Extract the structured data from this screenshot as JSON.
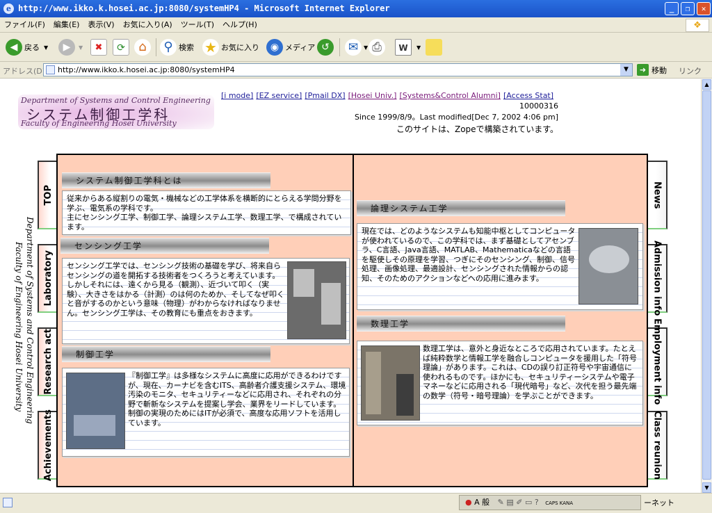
{
  "window": {
    "title": "http://www.ikko.k.hosei.ac.jp:8080/systemHP4 - Microsoft Internet Explorer"
  },
  "menu": [
    "ファイル(F)",
    "編集(E)",
    "表示(V)",
    "お気に入り(A)",
    "ツール(T)",
    "ヘルプ(H)"
  ],
  "toolbar": {
    "back": "戻る",
    "search": "検索",
    "favorites": "お気に入り",
    "media": "メディア"
  },
  "address": {
    "label": "アドレス(D)",
    "url": "http://www.ikko.k.hosei.ac.jp:8080/systemHP4",
    "go": "移動",
    "links": "リンク"
  },
  "header": {
    "logo_en_top": "Department of Systems and Control Engineering",
    "logo_jp": "システム制御工学科",
    "logo_en_bottom": "Faculty of Engineering Hosei University",
    "links": [
      "[i mode]",
      "[EZ service]",
      "[Pmail DX]",
      "[Hosei Univ.]",
      "[Systems&Control Alumni]",
      "[Access Stat]"
    ],
    "counter": "10000316",
    "since": "Since 1999/8/9。Last modified[Dec 7, 2002 4:06 pm]",
    "zope": "このサイトは、Zopeで構築されています。"
  },
  "sidebar_text": [
    "Department of Systems and Control Engineering",
    "Faculty of Engineering Hosei University"
  ],
  "tabs_left": [
    "TOP",
    "Laboratory",
    "Research act",
    "Achievements"
  ],
  "tabs_right": [
    "News",
    "Admission info",
    "Employment info",
    "Class reunion"
  ],
  "sections": {
    "about": {
      "title": "システム制御工学科とは",
      "text": "従来からある縦割りの電気・機械などの工学体系を横断的にとらえる学問分野を学ぶ、電気系の学科です。\n主にセンシング工学、制御工学、論理システム工学、数理工学、で構成されています。"
    },
    "sensing": {
      "title": "センシング工学",
      "text": "センシング工学では、センシング技術の基礎を学び、将来自らセンシングの道を開拓する技術者をつくろうと考えています。しかしそれには、遠くから見る（観測）、近づいて叩く（実験）、大きさをはかる（計測）のは何のためか、そしてなぜ叩くと音がするのかという意味（物理）がわからなければなりません。センシング工学は、その教育にも重点をおきます。"
    },
    "control": {
      "title": "制御工学",
      "text": "『制御工学』は多様なシステムに高度に応用ができるわけですが、現在、カーナビを含むITS、高齢者介護支援システム、環境汚染のモニタ、セキュリティーなどに応用され、それぞれの分野で斬新なシステムを提案し学会、業界をリードしています。制御の実現のためにはITが必須で、高度な応用ソフトを活用しています。"
    },
    "logic": {
      "title": "論理システム工学",
      "text": "現在では、どのようなシステムも知能中枢としてコンピュータが使われているので、この学科では、まず基礎としてアセンブラ、C言語、Java言語、MATLAB、Mathematicaなどの言語を駆使しその原理を学習、つぎにそのセンシング、制御、信号処理、画像処理、最適設計、センシングされた情報からの認知、そのためのアクションなどへの応用に進みます。"
    },
    "math": {
      "title": "数理工学",
      "text": "数理工学は、意外と身近なところで応用されています。たとえば純粋数学と情報工学を融合しコンピュータを援用した「符号理論」があります。これは、CDの誤り訂正符号や宇宙通信に使われるものです。ほかにも、セキュリティーシステムや電子マネーなどに応用される「現代暗号」など、次代を担う最先端の数学（符号・暗号理論）を学ぶことができます。"
    }
  },
  "status": {
    "ime": "A 般",
    "caps": "CAPS KANA",
    "zone": "ーネット"
  }
}
